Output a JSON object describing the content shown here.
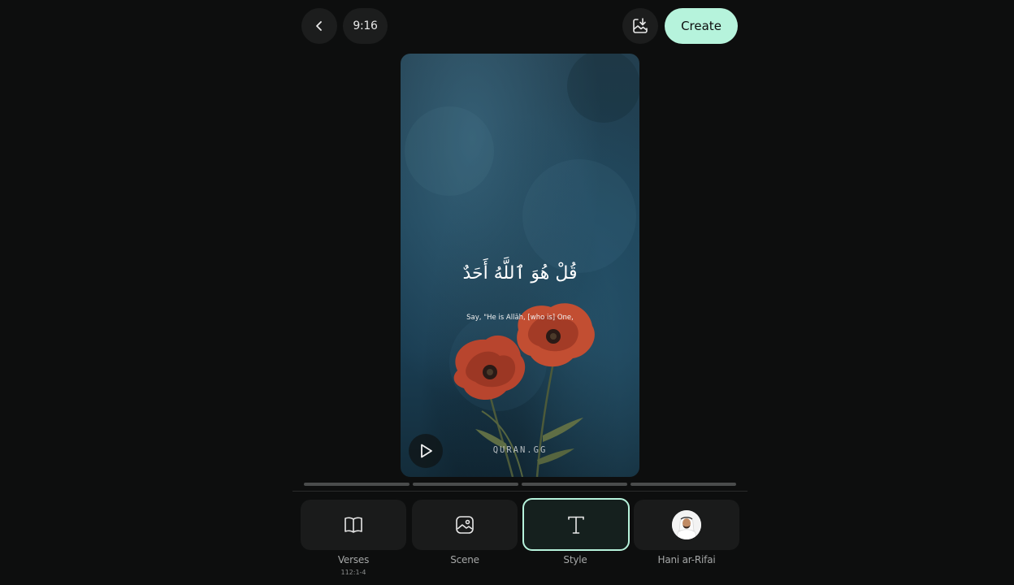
{
  "header": {
    "aspect_ratio_label": "9:16",
    "create_label": "Create"
  },
  "preview": {
    "arabic_verse": "قُلْ هُوَ ٱللَّهُ أَحَدٌ",
    "translation": "Say, \"He is Allāh, [who is] One,",
    "watermark": "QURAN.GG"
  },
  "progress": {
    "segment_count": 4
  },
  "tabs": [
    {
      "label": "Verses",
      "sublabel": "112:1-4",
      "icon": "book-icon",
      "active": false
    },
    {
      "label": "Scene",
      "sublabel": "",
      "icon": "image-icon",
      "active": false
    },
    {
      "label": "Style",
      "sublabel": "",
      "icon": "text-icon",
      "active": true
    },
    {
      "label": "Hani ar-Rifai",
      "sublabel": "",
      "icon": "reciter-avatar",
      "active": false
    }
  ],
  "colors": {
    "background": "#0d0e0e",
    "accent": "#b6f3dc",
    "surface": "#1a1b1b"
  }
}
